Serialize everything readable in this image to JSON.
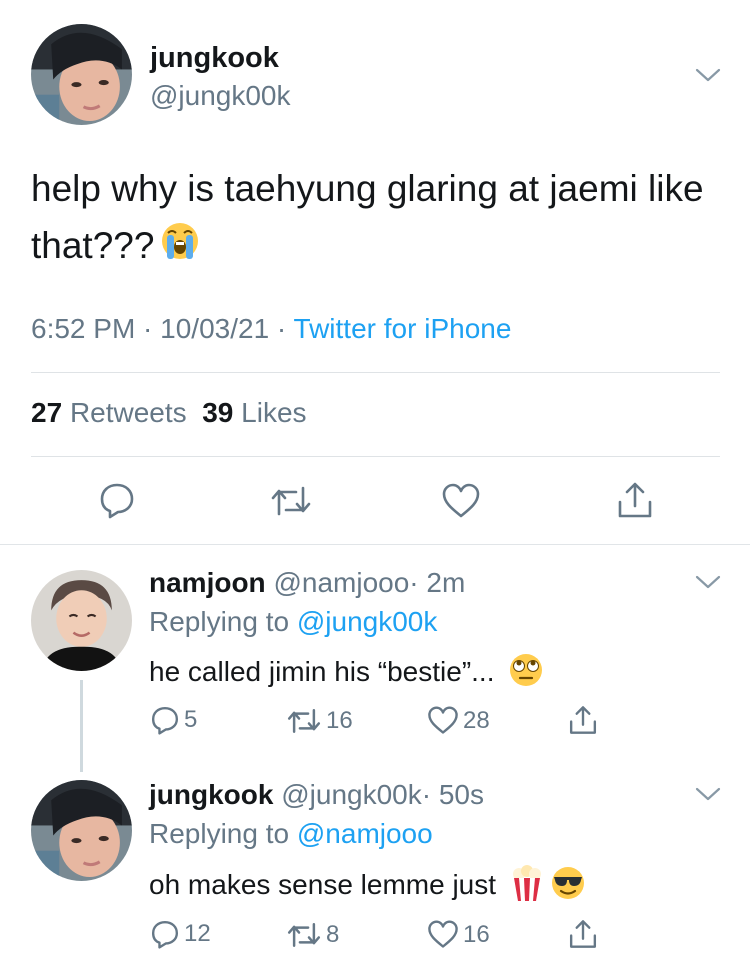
{
  "main_tweet": {
    "name": "jungkook",
    "handle": "@jungk00k",
    "text": "help why is taehyung glaring at jaemi like that???",
    "emoji": "crying-face",
    "time": "6:52 PM · 10/03/21 · ",
    "source": "Twitter for iPhone",
    "retweets_count": "27",
    "retweets_label": "Retweets",
    "likes_count": "39",
    "likes_label": "Likes"
  },
  "replies": [
    {
      "name": "namjoon",
      "handle": "@namjooo",
      "time": "· 2m",
      "replying_prefix": "Replying to ",
      "replying_to": "@jungk00k",
      "text": "he called jimin his “bestie”...",
      "emojis": [
        "eye-roll-face"
      ],
      "replies": "5",
      "retweets": "16",
      "likes": "28"
    },
    {
      "name": "jungkook",
      "handle": "@jungk00k",
      "time": "· 50s",
      "replying_prefix": "Replying to ",
      "replying_to": "@namjooo",
      "text": "oh makes sense lemme just",
      "emojis": [
        "popcorn",
        "sunglasses-face"
      ],
      "replies": "12",
      "retweets": "8",
      "likes": "16"
    }
  ],
  "colors": {
    "text": "#14171a",
    "secondary": "#657786",
    "link": "#1da1f2",
    "divider": "#dfe3e6"
  }
}
